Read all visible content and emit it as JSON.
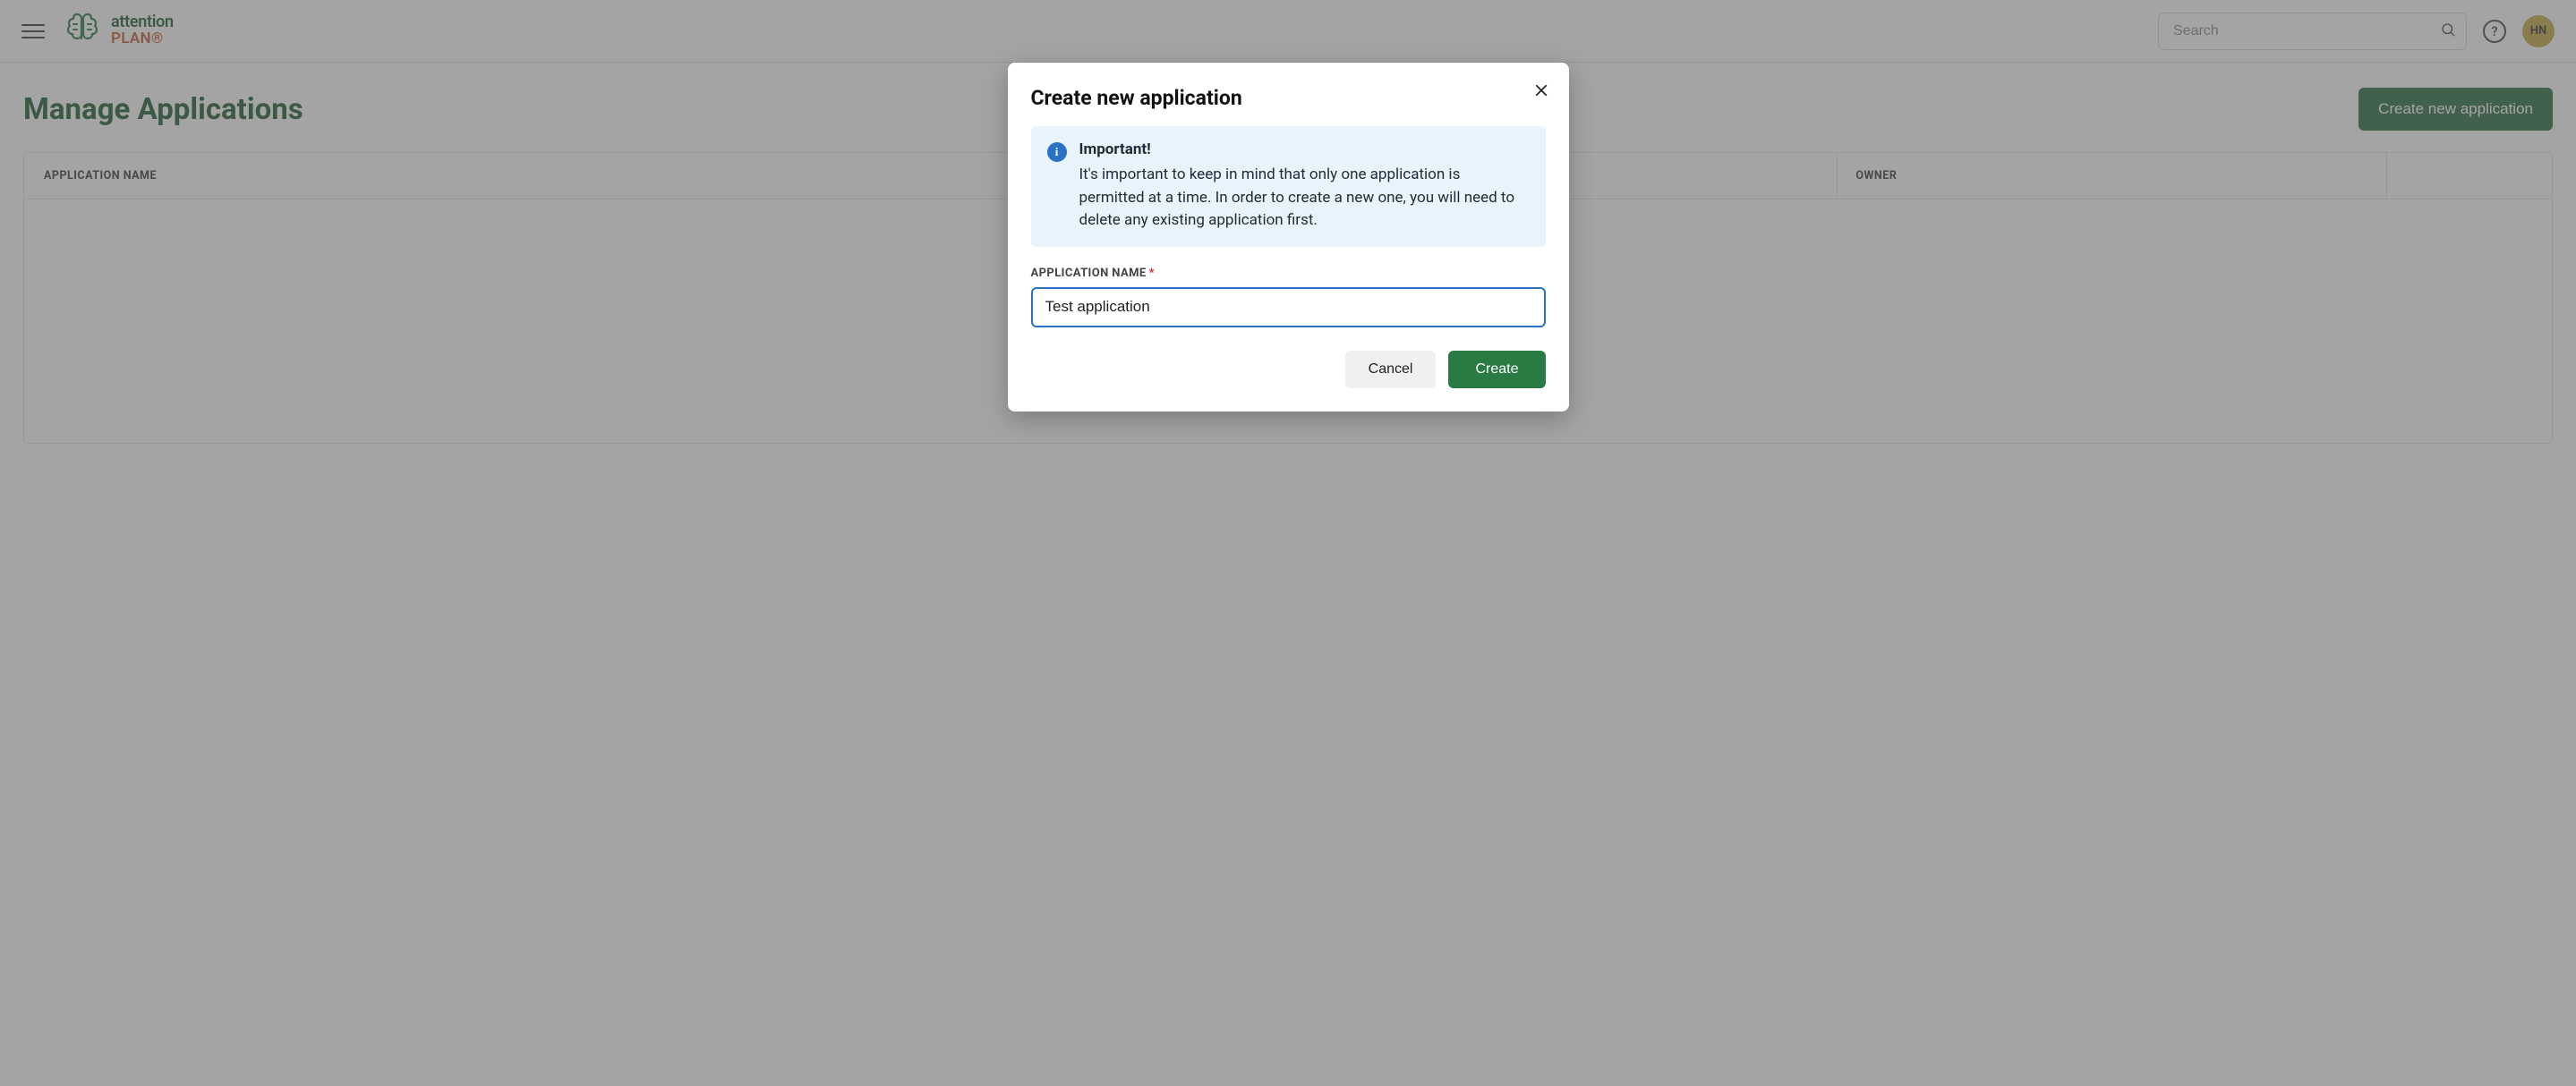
{
  "header": {
    "logo_primary": "attention",
    "logo_secondary": "PLAN®",
    "search_placeholder": "Search",
    "avatar_initials": "HN"
  },
  "page": {
    "title": "Manage Applications",
    "create_button": "Create new application",
    "table": {
      "columns": {
        "name": "APPLICATION NAME",
        "owner": "OWNER"
      },
      "rows": []
    }
  },
  "modal": {
    "title": "Create new application",
    "notice": {
      "heading": "Important!",
      "body": "It's important to keep in mind that only one application is permitted at a time. In order to create a new one, you will need to delete any existing application first."
    },
    "field": {
      "label": "APPLICATION NAME",
      "required_marker": "*",
      "value": "Test application"
    },
    "actions": {
      "cancel": "Cancel",
      "create": "Create"
    }
  }
}
